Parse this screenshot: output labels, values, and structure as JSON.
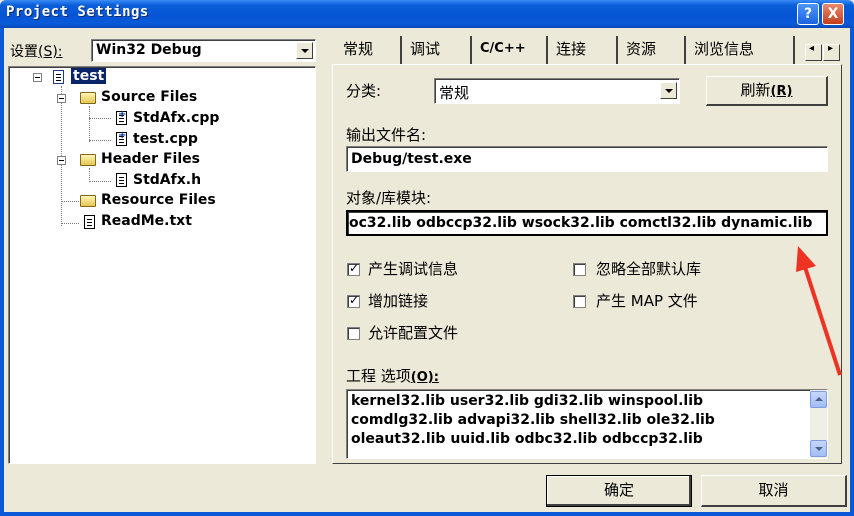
{
  "window": {
    "title": "Project Settings",
    "help_btn": "?",
    "close_btn": "X"
  },
  "settings": {
    "label": "设置",
    "hotkey": "(S):",
    "combo_value": "Win32 Debug"
  },
  "tree": {
    "root": "test",
    "source_files": "Source Files",
    "stdafx_cpp": "StdAfx.cpp",
    "test_cpp": "test.cpp",
    "header_files": "Header Files",
    "stdafx_h": "StdAfx.h",
    "resource_files": "Resource Files",
    "readme": "ReadMe.txt"
  },
  "tabs": {
    "t1": "常规",
    "t2": "调试",
    "t3": "C/C++",
    "t4": "连接",
    "t5": "资源",
    "t6": "浏览信息",
    "scroll": "◂▸"
  },
  "category": {
    "label": "分类:",
    "value": "常规",
    "refresh": "刷新",
    "refresh_key": "(R)"
  },
  "output": {
    "label": "输出文件名:",
    "value": "Debug/test.exe"
  },
  "objlib": {
    "label": "对象/库模块:",
    "value": "oc32.lib odbccp32.lib wsock32.lib comctl32.lib dynamic.lib"
  },
  "checks": {
    "debug_info": "产生调试信息",
    "ignore_libs": "忽略全部默认库",
    "incremental": "增加链接",
    "map_file": "产生 MAP 文件",
    "profiling": "允许配置文件"
  },
  "project_options": {
    "label": "工程 选项",
    "key": "(O):",
    "line1": "kernel32.lib user32.lib gdi32.lib winspool.lib",
    "line2": "comdlg32.lib advapi32.lib shell32.lib ole32.lib",
    "line3": "oleaut32.lib uuid.lib odbc32.lib odbccp32.lib"
  },
  "buttons": {
    "ok": "确定",
    "cancel": "取消"
  },
  "colors": {
    "title_bar": "#0654d6",
    "selection": "#0a246a",
    "annotation_arrow": "#ee3322"
  }
}
